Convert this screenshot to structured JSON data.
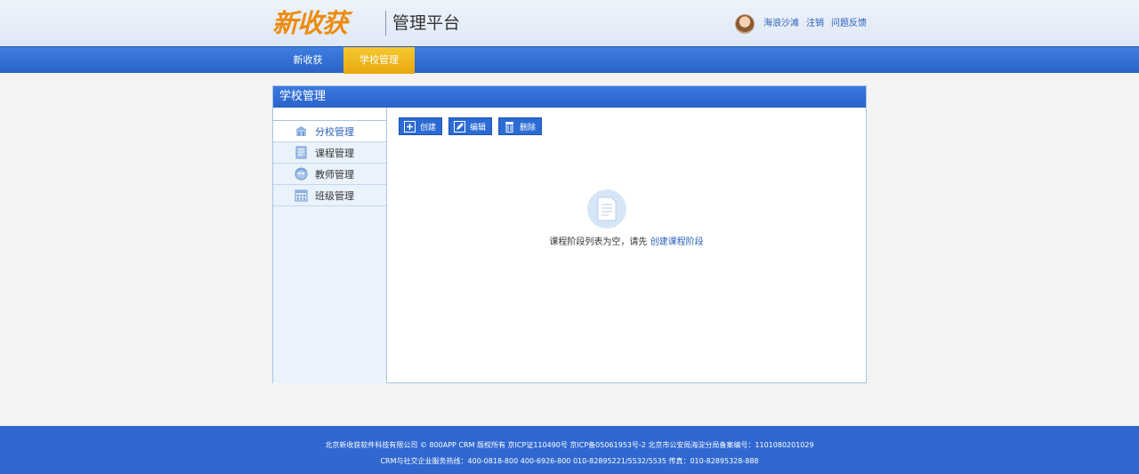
{
  "header": {
    "logo_text": "新收获",
    "logo_tm": "™",
    "platform_title": "管理平台",
    "user_name": "海浪沙滩",
    "logout_label": "注销",
    "feedback_label": "问题反馈"
  },
  "nav": {
    "tabs": [
      {
        "label": "新收获"
      },
      {
        "label": "学校管理"
      }
    ],
    "active_index": 1
  },
  "panel": {
    "title": "学校管理",
    "sidebar": {
      "items": [
        {
          "label": "分校管理",
          "icon": "school-icon"
        },
        {
          "label": "课程管理",
          "icon": "course-icon"
        },
        {
          "label": "教师管理",
          "icon": "teacher-icon"
        },
        {
          "label": "班级管理",
          "icon": "calendar-icon"
        }
      ],
      "active_index": 0
    },
    "toolbar": {
      "create_label": "创建",
      "edit_label": "编辑",
      "delete_label": "删除"
    },
    "empty": {
      "message": "课程阶段列表为空，请先",
      "link_label": "创建课程阶段"
    }
  },
  "footer": {
    "line1": "北京新收获软件科技有限公司 © 800APP CRM 版权所有 京ICP证110490号 京ICP备05061953号-2 北京市公安局海淀分局备案编号：1101080201029",
    "line2": "CRM与社交企业服务热线：400-0818-800 400-6926-800 010-82895221/5532/5535 传真：010-82895328-888"
  },
  "colors": {
    "brand_orange": "#ec8b0e",
    "nav_blue": "#2a63c6",
    "active_tab": "#e7a80e",
    "link_blue": "#2b5fb8"
  }
}
